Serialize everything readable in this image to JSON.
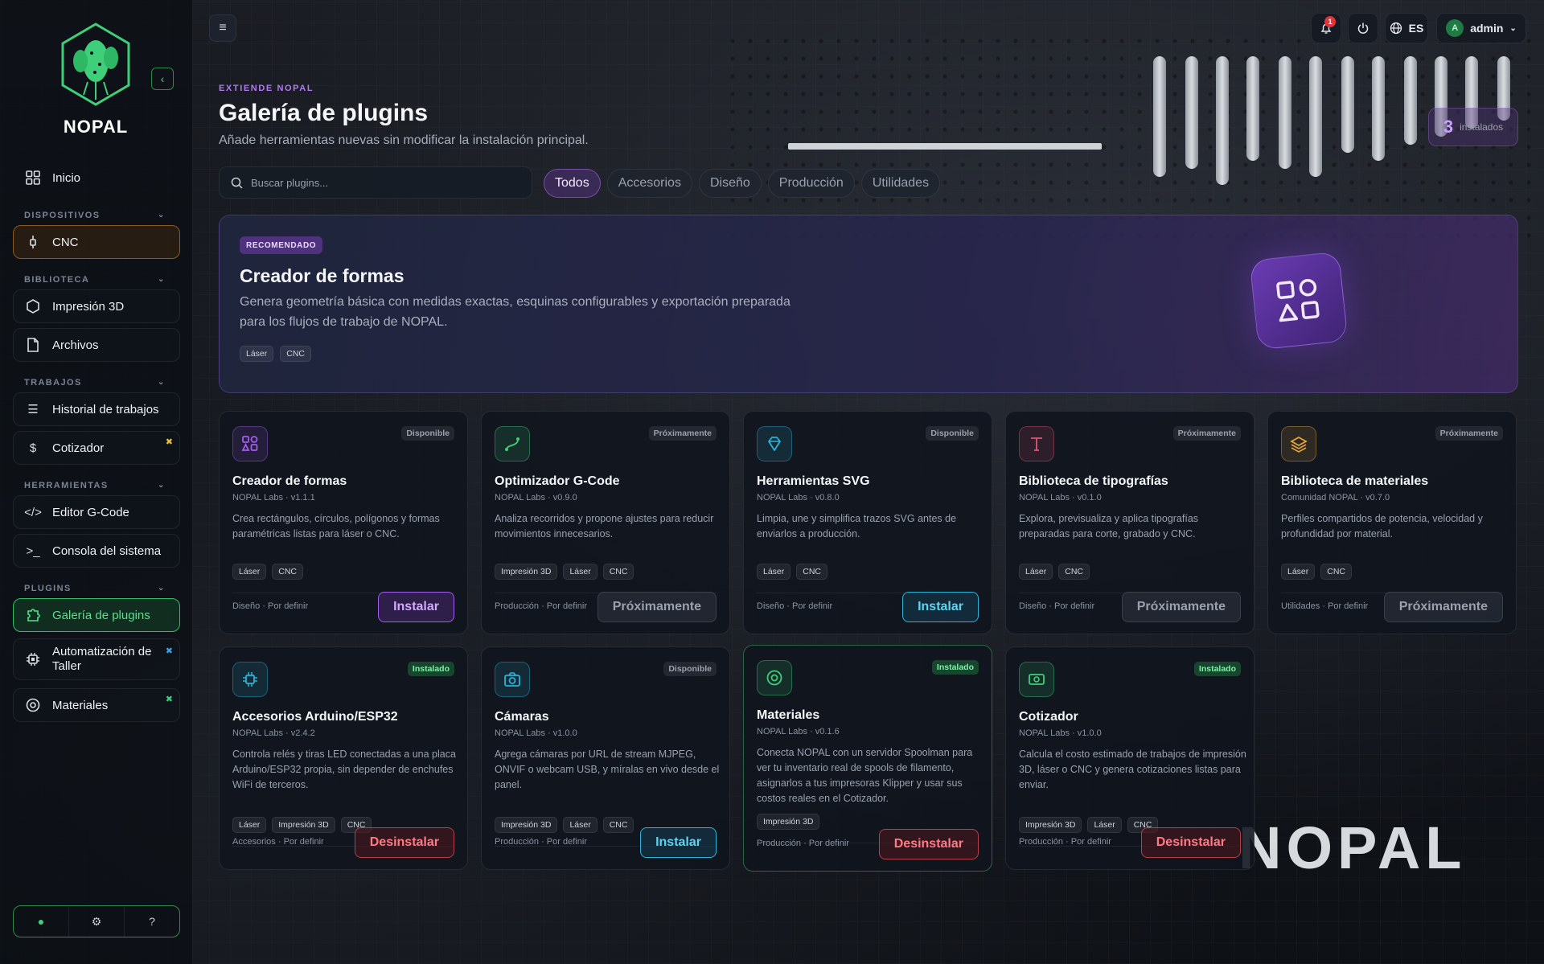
{
  "app": {
    "brand": "NOPAL"
  },
  "sidebar": {
    "items": [
      {
        "label": "Inicio",
        "icon": "grid-icon"
      },
      {
        "label": "CNC",
        "icon": "spindle-icon"
      },
      {
        "label": "Impresión 3D",
        "icon": "hexagon-icon"
      },
      {
        "label": "Archivos",
        "icon": "file-icon"
      },
      {
        "label": "Historial de trabajos",
        "icon": "list-icon"
      },
      {
        "label": "Cotizador",
        "icon": "dollar-icon"
      },
      {
        "label": "Editor G-Code",
        "icon": "code-icon"
      },
      {
        "label": "Consola del sistema",
        "icon": "terminal-icon"
      },
      {
        "label": "Galería de plugins",
        "icon": "puzzle-icon"
      },
      {
        "label": "Automatización de Taller",
        "icon": "chip-icon"
      },
      {
        "label": "Materiales",
        "icon": "spool-icon"
      }
    ],
    "sections": [
      "DISPOSITIVOS",
      "BIBLIOTECA",
      "TRABAJOS",
      "HERRAMIENTAS",
      "PLUGINS"
    ]
  },
  "topbar": {
    "notifications": "1",
    "language": "ES",
    "avatar_initial": "A",
    "user": "admin"
  },
  "header": {
    "eyebrow": "EXTIENDE NOPAL",
    "title": "Galería de plugins",
    "subtitle": "Añade herramientas nuevas sin modificar la instalación principal.",
    "installed_count": "3",
    "installed_label": "instalados"
  },
  "search": {
    "placeholder": "Buscar plugins..."
  },
  "filters": [
    "Todos",
    "Accesorios",
    "Diseño",
    "Producción",
    "Utilidades"
  ],
  "featured": {
    "badge": "RECOMENDADO",
    "title": "Creador de formas",
    "description": "Genera geometría básica con medidas exactas, esquinas configurables y exportación preparada para los flujos de trabajo de NOPAL.",
    "tags": [
      "Láser",
      "CNC"
    ]
  },
  "cards": [
    {
      "title": "Creador de formas",
      "meta": "NOPAL Labs · v1.1.1",
      "status": "Disponible",
      "desc": "Crea rectángulos, círculos, polígonos y formas paramétricas listas para láser o CNC.",
      "tags": [
        "Láser",
        "CNC"
      ],
      "foot": "Diseño · Por definir",
      "button": "Instalar",
      "color": "#a35cf0"
    },
    {
      "title": "Optimizador G-Code",
      "meta": "NOPAL Labs · v0.9.0",
      "status": "Próximamente",
      "desc": "Analiza recorridos y propone ajustes para reducir movimientos innecesarios.",
      "tags": [
        "Impresión 3D",
        "Láser",
        "CNC"
      ],
      "foot": "Producción · Por definir",
      "button": "Próximamente",
      "color": "#3fcf7a"
    },
    {
      "title": "Herramientas SVG",
      "meta": "NOPAL Labs · v0.8.0",
      "status": "Disponible",
      "desc": "Limpia, une y simplifica trazos SVG antes de enviarlos a producción.",
      "tags": [
        "Láser",
        "CNC"
      ],
      "foot": "Diseño · Por definir",
      "button": "Instalar",
      "color": "#2bb4d6"
    },
    {
      "title": "Biblioteca de tipografías",
      "meta": "NOPAL Labs · v0.1.0",
      "status": "Próximamente",
      "desc": "Explora, previsualiza y aplica tipografías preparadas para corte, grabado y CNC.",
      "tags": [
        "Láser",
        "CNC"
      ],
      "foot": "Diseño · Por definir",
      "button": "Próximamente",
      "color": "#e0557a"
    },
    {
      "title": "Biblioteca de materiales",
      "meta": "Comunidad NOPAL · v0.7.0",
      "status": "Próximamente",
      "desc": "Perfiles compartidos de potencia, velocidad y profundidad por material.",
      "tags": [
        "Láser",
        "CNC"
      ],
      "foot": "Utilidades · Por definir",
      "button": "Próximamente",
      "color": "#e6a43a"
    },
    {
      "title": "Accesorios Arduino/ESP32",
      "meta": "NOPAL Labs · v2.4.2",
      "status": "Instalado",
      "desc": "Controla relés y tiras LED conectadas a una placa Arduino/ESP32 propia, sin depender de enchufes WiFi de terceros.",
      "tags": [
        "Láser",
        "Impresión 3D",
        "CNC"
      ],
      "foot": "Accesorios · Por definir",
      "button": "Desinstalar",
      "color": "#2bb4d6"
    },
    {
      "title": "Cámaras",
      "meta": "NOPAL Labs · v1.0.0",
      "status": "Disponible",
      "desc": "Agrega cámaras por URL de stream MJPEG, ONVIF o webcam USB, y míralas en vivo desde el panel.",
      "tags": [
        "Impresión 3D",
        "Láser",
        "CNC"
      ],
      "foot": "Producción · Por definir",
      "button": "Instalar",
      "color": "#2bb4d6"
    },
    {
      "title": "Materiales",
      "meta": "NOPAL Labs · v0.1.6",
      "status": "Instalado",
      "desc": "Conecta NOPAL con un servidor Spoolman para ver tu inventario real de spools de filamento, asignarlos a tus impresoras Klipper y usar sus costos reales en el Cotizador.",
      "tags": [
        "Impresión 3D"
      ],
      "foot": "Producción · Por definir",
      "button": "Desinstalar",
      "color": "#3fcf7a"
    },
    {
      "title": "Cotizador",
      "meta": "NOPAL Labs · v1.0.0",
      "status": "Instalado",
      "desc": "Calcula el costo estimado de trabajos de impresión 3D, láser o CNC y genera cotizaciones listas para enviar.",
      "tags": [
        "Impresión 3D",
        "Láser",
        "CNC"
      ],
      "foot": "Producción · Por definir",
      "button": "Desinstalar",
      "color": "#3fcf7a"
    }
  ]
}
